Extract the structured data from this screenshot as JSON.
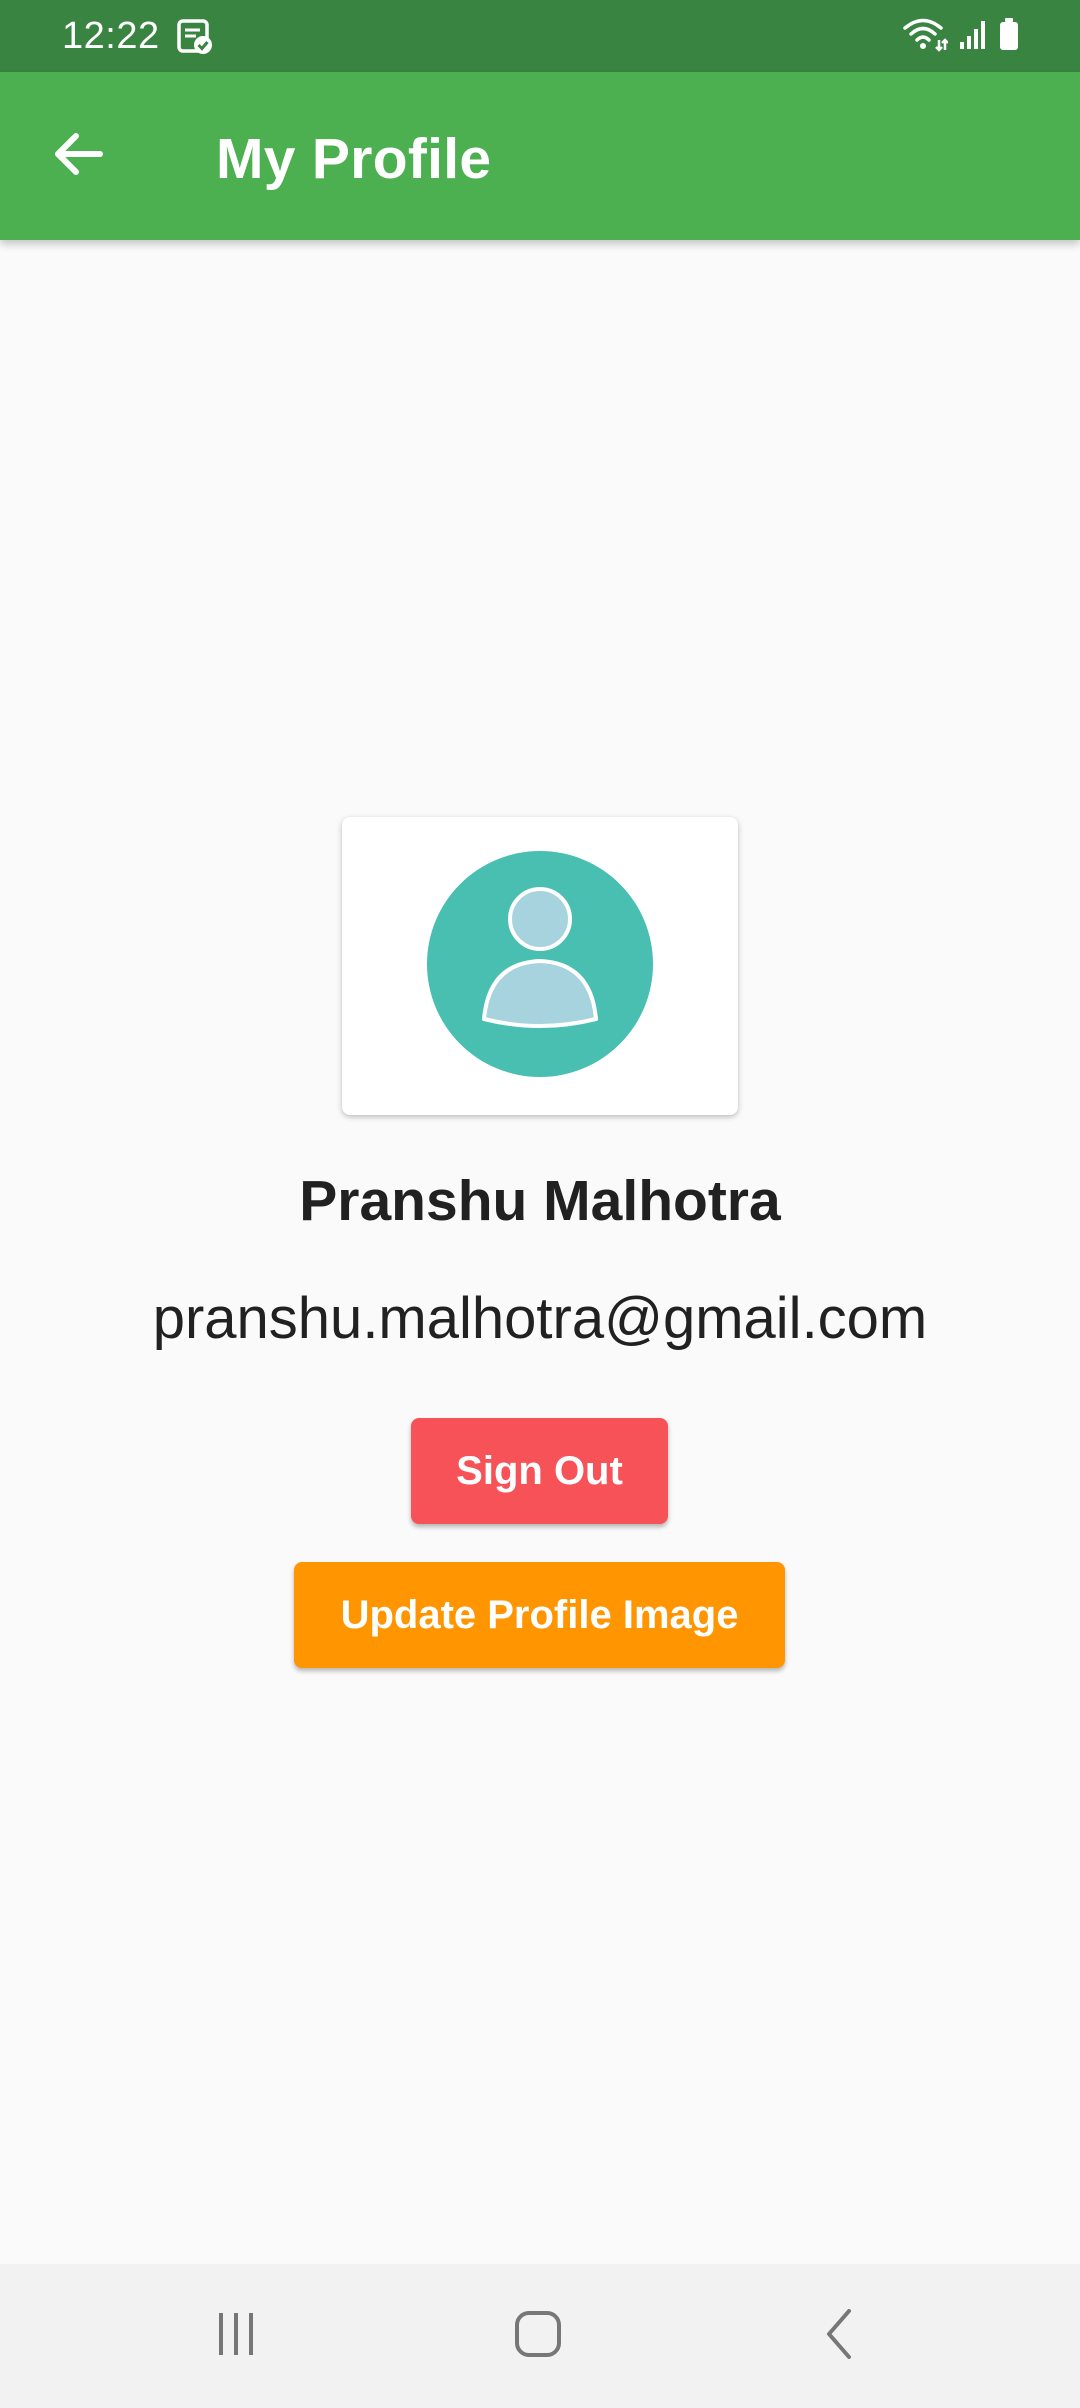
{
  "status_bar": {
    "time": "12:22",
    "icons": [
      "notification-icon",
      "wifi-icon",
      "signal-icon",
      "battery-icon"
    ]
  },
  "app_bar": {
    "title": "My Profile",
    "back_icon": "arrow-back-icon"
  },
  "profile": {
    "avatar_icon": "person-icon",
    "name": "Pranshu Malhotra",
    "email": "pranshu.malhotra@gmail.com"
  },
  "actions": {
    "sign_out_label": "Sign Out",
    "update_image_label": "Update Profile Image"
  },
  "nav_bar": {
    "items": [
      "recent-apps-icon",
      "home-icon",
      "back-icon"
    ]
  },
  "colors": {
    "status_bar": "#3a8442",
    "app_bar": "#4caf50",
    "avatar_circle": "#48bfb0",
    "avatar_figure": "#a7d3df",
    "sign_out": "#f75257",
    "update_image": "#ff9500",
    "background": "#fafafa"
  }
}
